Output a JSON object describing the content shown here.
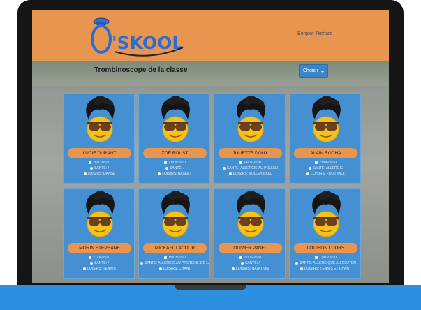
{
  "app": {
    "logo_text": "Ô'SKOOL",
    "greeting": "Bonjour Richard"
  },
  "page": {
    "title": "Trombinoscope de la classe",
    "dropdown_label": "Choisir"
  },
  "colors": {
    "header": "#e8964f",
    "card": "#4590d2",
    "name_bar": "#e8964f",
    "dropdown": "#3a86c8",
    "laptop_base": "#2e8fe0"
  },
  "icons": {
    "birthday": "calendar-icon",
    "health": "medical-icon",
    "hobbies": "leaf-icon"
  },
  "students": [
    {
      "name": "LUCIE DURANT",
      "birthdate": "26/12/2010",
      "sante": "SANTE: /",
      "loisirs": "LOISIRS: DANSE"
    },
    {
      "name": "ZOÉ ROUST",
      "birthdate": "21/05/2010",
      "sante": "SANTE: /",
      "loisirs": "LOISIRS: BASKET"
    },
    {
      "name": "JULIETTE DOUX",
      "birthdate": "14/02/2010",
      "sante": "SANTE: ALLERGIE AU POLLEN",
      "loisirs": "LOISIRS: VOLLEY-BALL"
    },
    {
      "name": "ALAIN ROCHA",
      "birthdate": "23/06/2010",
      "sante": "SANTE: ALLERGIE",
      "loisirs": "LOISIRS: FOOTBALL"
    },
    {
      "name": "MORIN STEPHANE",
      "birthdate": "21/04/2010",
      "sante": "SANTE: /",
      "loisirs": "LOISIRS: TENNIS"
    },
    {
      "name": "MICKAEL LACOUR",
      "birthdate": "15/03/2010",
      "sante": "SANTE: ALLERGIE AU PROTEINE DE LAIT",
      "loisirs": "LOISIRS: CHANT"
    },
    {
      "name": "OLIVIER PANEL",
      "birthdate": "22/06/2010",
      "sante": "SANTE: /",
      "loisirs": "LOISIRS: NATATION"
    },
    {
      "name": "LOUISON LOURS",
      "birthdate": "17/03/2010",
      "sante": "SANTE: ALLERGIQUE AU GLUTEN",
      "loisirs": "LOISIRS: TENNIS ET CHANT"
    }
  ]
}
